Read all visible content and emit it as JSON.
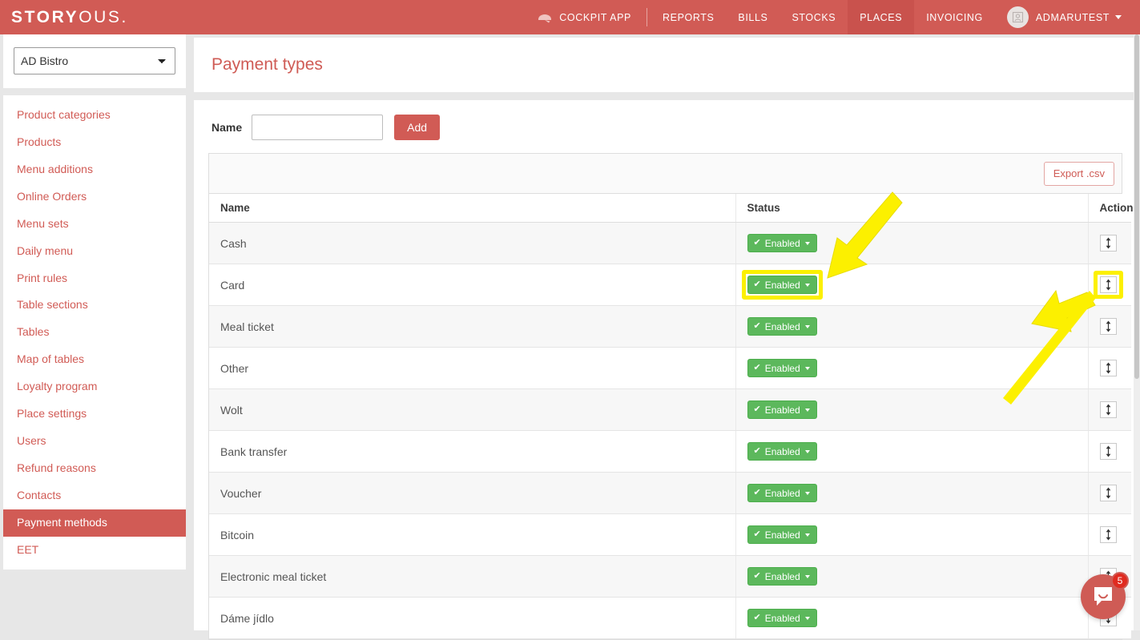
{
  "navbar": {
    "brand_strong": "STORY",
    "brand_light": "OUS.",
    "items": [
      {
        "label": "COCKPIT APP",
        "icon": "cockpit-icon",
        "active": false
      },
      {
        "label": "REPORTS",
        "active": false
      },
      {
        "label": "BILLS",
        "active": false
      },
      {
        "label": "STOCKS",
        "active": false
      },
      {
        "label": "PLACES",
        "active": true
      },
      {
        "label": "INVOICING",
        "active": false
      }
    ],
    "user": {
      "name": "ADMARUTEST",
      "avatar_icon": "user-portrait-icon",
      "caret": "caret-down-icon"
    }
  },
  "sidebar": {
    "place_select": {
      "value": "AD Bistro",
      "options": [
        "AD Bistro"
      ]
    },
    "items": [
      {
        "label": "Product categories",
        "active": false
      },
      {
        "label": "Products",
        "active": false
      },
      {
        "label": "Menu additions",
        "active": false
      },
      {
        "label": "Online Orders",
        "active": false
      },
      {
        "label": "Menu sets",
        "active": false
      },
      {
        "label": "Daily menu",
        "active": false
      },
      {
        "label": "Print rules",
        "active": false
      },
      {
        "label": "Table sections",
        "active": false
      },
      {
        "label": "Tables",
        "active": false
      },
      {
        "label": "Map of tables",
        "active": false
      },
      {
        "label": "Loyalty program",
        "active": false
      },
      {
        "label": "Place settings",
        "active": false
      },
      {
        "label": "Users",
        "active": false
      },
      {
        "label": "Refund reasons",
        "active": false
      },
      {
        "label": "Contacts",
        "active": false
      },
      {
        "label": "Payment methods",
        "active": true
      },
      {
        "label": "EET",
        "active": false
      }
    ]
  },
  "main": {
    "page_title": "Payment types",
    "form": {
      "name_label": "Name",
      "name_value": "",
      "name_placeholder": "",
      "add_label": "Add"
    },
    "toolbar": {
      "export_label": "Export .csv"
    },
    "table": {
      "columns": [
        "Name",
        "Status",
        "Action"
      ],
      "status_label": "Enabled",
      "action_icon": "sort-updown-icon",
      "rows": [
        {
          "name": "Cash",
          "status": "Enabled",
          "highlight_status": false,
          "highlight_action": false
        },
        {
          "name": "Card",
          "status": "Enabled",
          "highlight_status": true,
          "highlight_action": true
        },
        {
          "name": "Meal ticket",
          "status": "Enabled",
          "highlight_status": false,
          "highlight_action": false
        },
        {
          "name": "Other",
          "status": "Enabled",
          "highlight_status": false,
          "highlight_action": false
        },
        {
          "name": "Wolt",
          "status": "Enabled",
          "highlight_status": false,
          "highlight_action": false
        },
        {
          "name": "Bank transfer",
          "status": "Enabled",
          "highlight_status": false,
          "highlight_action": false
        },
        {
          "name": "Voucher",
          "status": "Enabled",
          "highlight_status": false,
          "highlight_action": false
        },
        {
          "name": "Bitcoin",
          "status": "Enabled",
          "highlight_status": false,
          "highlight_action": false
        },
        {
          "name": "Electronic meal ticket",
          "status": "Enabled",
          "highlight_status": false,
          "highlight_action": false
        },
        {
          "name": "Dáme jídlo",
          "status": "Enabled",
          "highlight_status": false,
          "highlight_action": false
        }
      ]
    }
  },
  "chat": {
    "unread_count": "5",
    "icon": "chat-bubble-icon"
  },
  "colors": {
    "brand_red": "#d15b55",
    "nav_active_red": "#c9524d",
    "status_green": "#5cb85c",
    "highlight_yellow": "#fcf000",
    "page_bg": "#e7e7e7"
  }
}
